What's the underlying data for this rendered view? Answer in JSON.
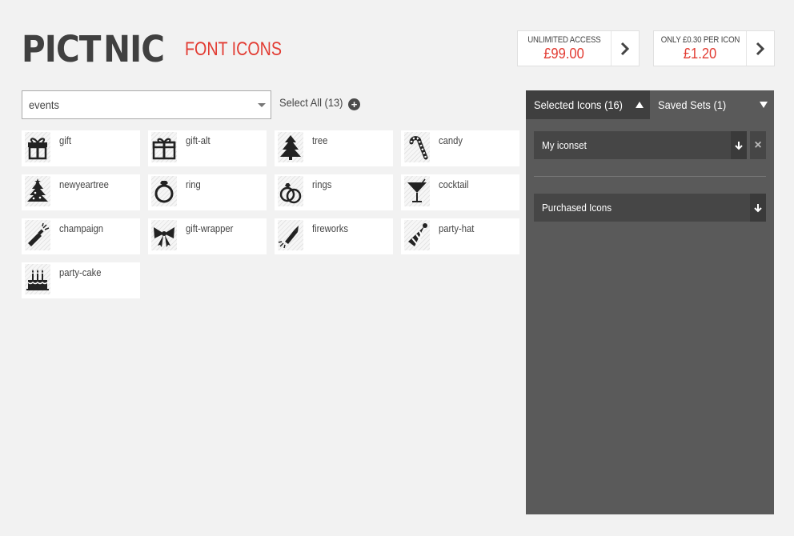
{
  "brand": {
    "wordmark_left": "PICT",
    "wordmark_right": "NIC",
    "sub": "FONT ICONS",
    "accent": "#e23c33"
  },
  "pricing": [
    {
      "label": "UNLIMITED ACCESS",
      "price": "£99.00"
    },
    {
      "label": "ONLY £0.30 PER ICON",
      "price": "£1.20"
    }
  ],
  "filter": {
    "selected": "events",
    "select_all": "Select All (13)"
  },
  "icons": [
    {
      "name": "gift",
      "icon": "gift-icon"
    },
    {
      "name": "gift-alt",
      "icon": "gift-alt-icon"
    },
    {
      "name": "tree",
      "icon": "tree-icon"
    },
    {
      "name": "candy",
      "icon": "candy-icon"
    },
    {
      "name": "newyeartree",
      "icon": "newyeartree-icon"
    },
    {
      "name": "ring",
      "icon": "ring-icon"
    },
    {
      "name": "rings",
      "icon": "rings-icon"
    },
    {
      "name": "cocktail",
      "icon": "cocktail-icon"
    },
    {
      "name": "champaign",
      "icon": "champaign-icon"
    },
    {
      "name": "gift-wrapper",
      "icon": "gift-wrapper-icon"
    },
    {
      "name": "fireworks",
      "icon": "fireworks-icon"
    },
    {
      "name": "party-hat",
      "icon": "party-hat-icon"
    },
    {
      "name": "party-cake",
      "icon": "party-cake-icon"
    }
  ],
  "panel": {
    "tab_selected": "Selected Icons (16)",
    "tab_saved": "Saved Sets (1)",
    "sets": [
      "My iconset"
    ],
    "purchased": "Purchased Icons"
  }
}
